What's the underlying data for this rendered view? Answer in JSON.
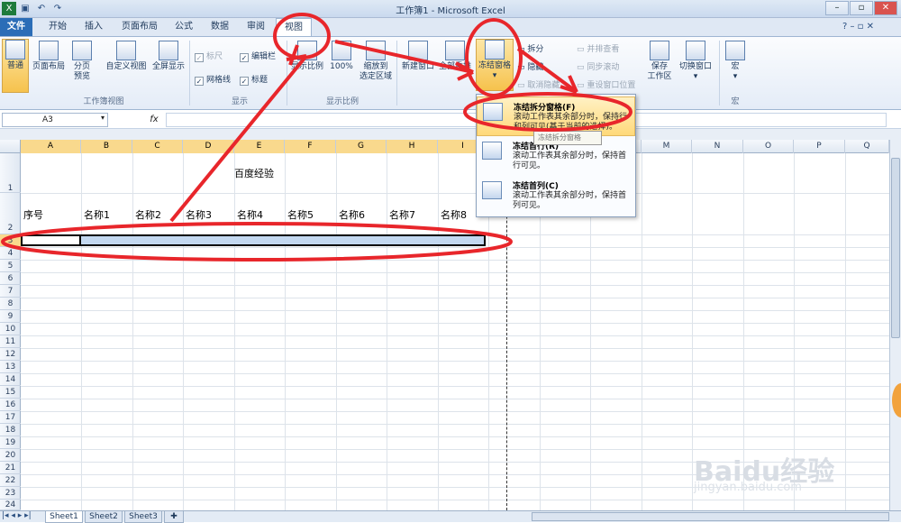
{
  "window": {
    "title": "工作簿1 - Microsoft Excel",
    "qa_icons": [
      "excel-icon",
      "save-icon",
      "undo-icon",
      "redo-icon"
    ],
    "controls": [
      "–",
      "▫",
      "✕"
    ],
    "inner_controls": [
      "?",
      "–",
      "▫",
      "✕"
    ]
  },
  "tabs": [
    "文件",
    "开始",
    "插入",
    "页面布局",
    "公式",
    "数据",
    "审阅",
    "视图"
  ],
  "ribbon": {
    "workbook_views": {
      "items": [
        "普通",
        "页面布局",
        "分页\n预览",
        "自定义视图",
        "全屏显示"
      ],
      "group": "工作簿视图"
    },
    "show": {
      "ruler": "标尺",
      "gridlines": "网格线",
      "formula_bar": "编辑栏",
      "headings": "标题",
      "group": "显示"
    },
    "zoom": {
      "items": [
        "显示比例",
        "100%",
        "缩放到\n选定区域"
      ],
      "group": "显示比例"
    },
    "window": {
      "new": "新建窗口",
      "arrange": "全部重排",
      "freeze": "冻结窗格",
      "split": "拆分",
      "hide": "隐藏",
      "unhide": "取消隐藏",
      "side_by_side": "并排查看",
      "sync_scroll": "同步滚动",
      "reset": "重设窗口位置",
      "save_ws": "保存\n工作区",
      "switch": "切换窗口",
      "group": "窗口"
    },
    "macro": {
      "label": "宏",
      "group": "宏"
    }
  },
  "formula_bar": {
    "name_box": "A3",
    "fx": "fx"
  },
  "columns": [
    "A",
    "B",
    "C",
    "D",
    "E",
    "F",
    "G",
    "H",
    "I",
    "J",
    "K",
    "L",
    "M",
    "N",
    "O",
    "P",
    "Q"
  ],
  "rows": [
    "1",
    "2",
    "3",
    "4",
    "5",
    "6",
    "7",
    "8",
    "9",
    "10",
    "11",
    "12",
    "13",
    "14",
    "15",
    "16",
    "17",
    "18",
    "19",
    "20",
    "21",
    "22",
    "23",
    "24"
  ],
  "cells": {
    "title": "百度经验",
    "headers": [
      "序号",
      "名称1",
      "名称2",
      "名称3",
      "名称4",
      "名称5",
      "名称6",
      "名称7",
      "名称8"
    ]
  },
  "freeze_menu": [
    {
      "title": "冻结拆分窗格(F)",
      "desc": "滚动工作表其余部分时，保持行和列可见(基于当前的选择)。"
    },
    {
      "title": "冻结首行(R)",
      "desc": "滚动工作表其余部分时，保持首行可见。"
    },
    {
      "title": "冻结首列(C)",
      "desc": "滚动工作表其余部分时，保持首列可见。"
    }
  ],
  "tooltip": "冻结拆分窗格",
  "sheets": [
    "Sheet1",
    "Sheet2",
    "Sheet3"
  ],
  "watermark": {
    "logo": "Baidu经验",
    "url": "jingyan.baidu.com"
  },
  "colors": {
    "annotation": "#e8262b",
    "file_tab": "#2b6db7",
    "selection": "#c3d8f0"
  }
}
